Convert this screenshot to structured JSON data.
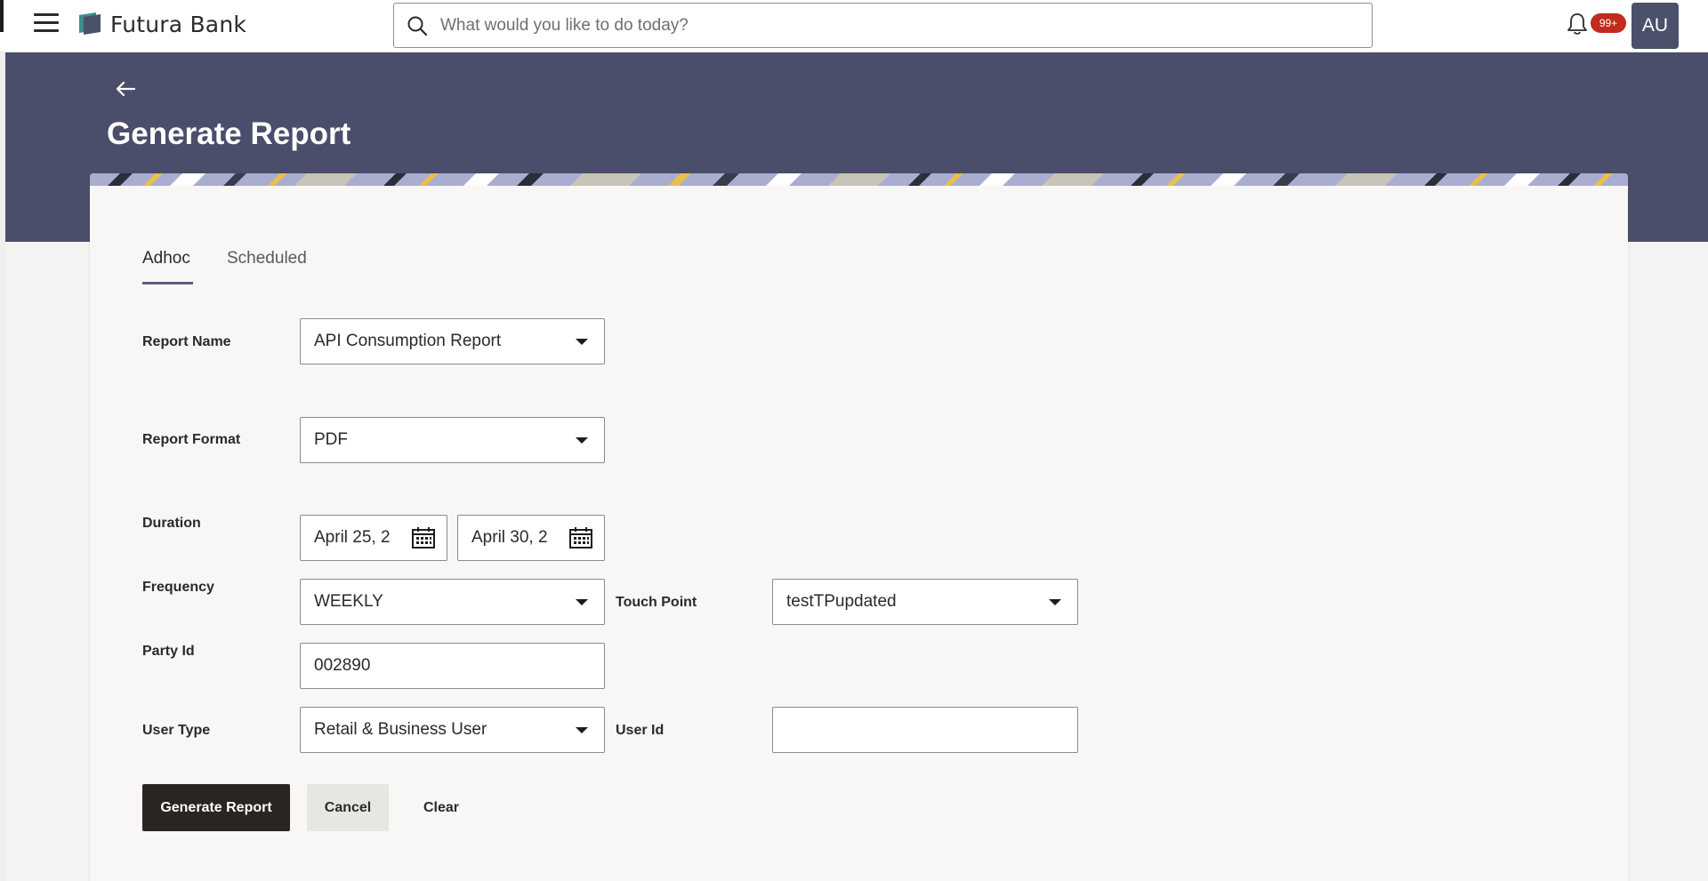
{
  "topbar": {
    "brand": "Futura Bank",
    "search_placeholder": "What would you like to do today?",
    "notification_badge": "99+",
    "avatar_initials": "AU"
  },
  "header": {
    "title": "Generate Report"
  },
  "tabs": [
    {
      "label": "Adhoc",
      "active": true
    },
    {
      "label": "Scheduled",
      "active": false
    }
  ],
  "form": {
    "report_name": {
      "label": "Report Name",
      "value": "API Consumption Report"
    },
    "report_format": {
      "label": "Report Format",
      "value": "PDF"
    },
    "duration": {
      "label": "Duration",
      "from": "April 25, 2",
      "to": "April 30, 2"
    },
    "frequency": {
      "label": "Frequency",
      "value": "WEEKLY"
    },
    "touch_point": {
      "label": "Touch Point",
      "value": "testTPupdated"
    },
    "party_id": {
      "label": "Party Id",
      "value": "002890"
    },
    "user_type": {
      "label": "User Type",
      "value": "Retail & Business User"
    },
    "user_id": {
      "label": "User Id",
      "value": ""
    }
  },
  "actions": {
    "generate": "Generate Report",
    "cancel": "Cancel",
    "clear": "Clear"
  },
  "colors": {
    "header_band": "#4a4e6a",
    "primary_button": "#2b2522",
    "badge": "#c02b1d",
    "avatar": "#4b506b"
  }
}
